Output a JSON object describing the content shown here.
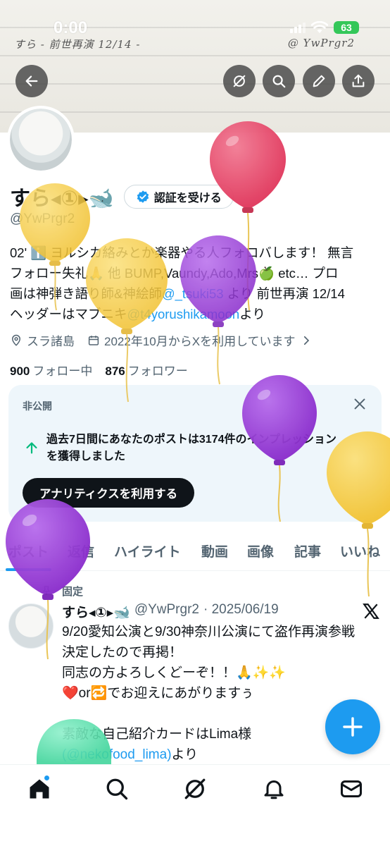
{
  "status_bar": {
    "time": "0:00",
    "battery": "63"
  },
  "banner": {
    "note_left": "すら - 前世再演 12/14 -",
    "note_right": "@ YwPrgr2"
  },
  "header_buttons": [
    "back-icon",
    "grok-icon",
    "search-icon",
    "edit-icon",
    "share-icon"
  ],
  "profile": {
    "display_name": "すら◂①▸🐋",
    "verify_label": "認証を受ける",
    "handle": "@YwPrgr2",
    "bio": {
      "line1": "02' ℹ️ ヨルシカ絡みとか楽器やる人フォロバします！ 無言",
      "line2": "フォロー失礼🙏 他 BUMP,Vaundy,Ado,Mrs🍏 etc… プロ",
      "line3_a": "画は神弾き語り師&神絵師",
      "line3_link": "@_tsuki53",
      "line3_b": " より 前世再演 12/14",
      "line4_a": "ヘッダーはマブニキ",
      "line4_link": "@t4yorushikamoon",
      "line4_b": "より"
    },
    "location": "スラ諸島",
    "joined": "2022年10月からXを利用しています",
    "following_count": "900",
    "following_label": "フォロー中",
    "followers_count": "876",
    "followers_label": "フォロワー"
  },
  "analytics_card": {
    "private_label": "非公開",
    "text_line1": "過去7日間にあなたのポストは3174件のインプレッション",
    "text_line2": "を獲得しました",
    "button_label": "アナリティクスを利用する"
  },
  "tabs": [
    {
      "label": "ポスト",
      "active": true
    },
    {
      "label": "返信",
      "active": false
    },
    {
      "label": "ハイライト",
      "active": false
    },
    {
      "label": "動画",
      "active": false
    },
    {
      "label": "画像",
      "active": false
    },
    {
      "label": "記事",
      "active": false
    },
    {
      "label": "いいね",
      "active": false
    }
  ],
  "pinned_post": {
    "pinned_label": "固定",
    "author_name": "すら◂①▸🐋",
    "author_handle": "@YwPrgr2",
    "date": "· 2025/06/19",
    "lines": [
      "9/20愛知公演と9/30神奈川公演にて盗作再演参戦",
      "決定したので再掲！",
      "同志の方よろしくどーぞ！！🙏✨✨",
      "❤️or🔁でお迎えにあがりますぅ",
      "",
      "素敵な自己紹介カードはLima様"
    ],
    "last_line_link": "(@nekofood_lima)",
    "last_line_tail": "より"
  },
  "bottom_nav": [
    "home-icon",
    "search-icon",
    "grok-icon",
    "notifications-icon",
    "messages-icon"
  ],
  "colors": {
    "accent": "#1d9bf0",
    "balloon_red": "#e94a6a",
    "balloon_yellow": "#f6cf4e",
    "balloon_purple": "#9b3fd8",
    "balloon_green": "#5fe0b0"
  }
}
